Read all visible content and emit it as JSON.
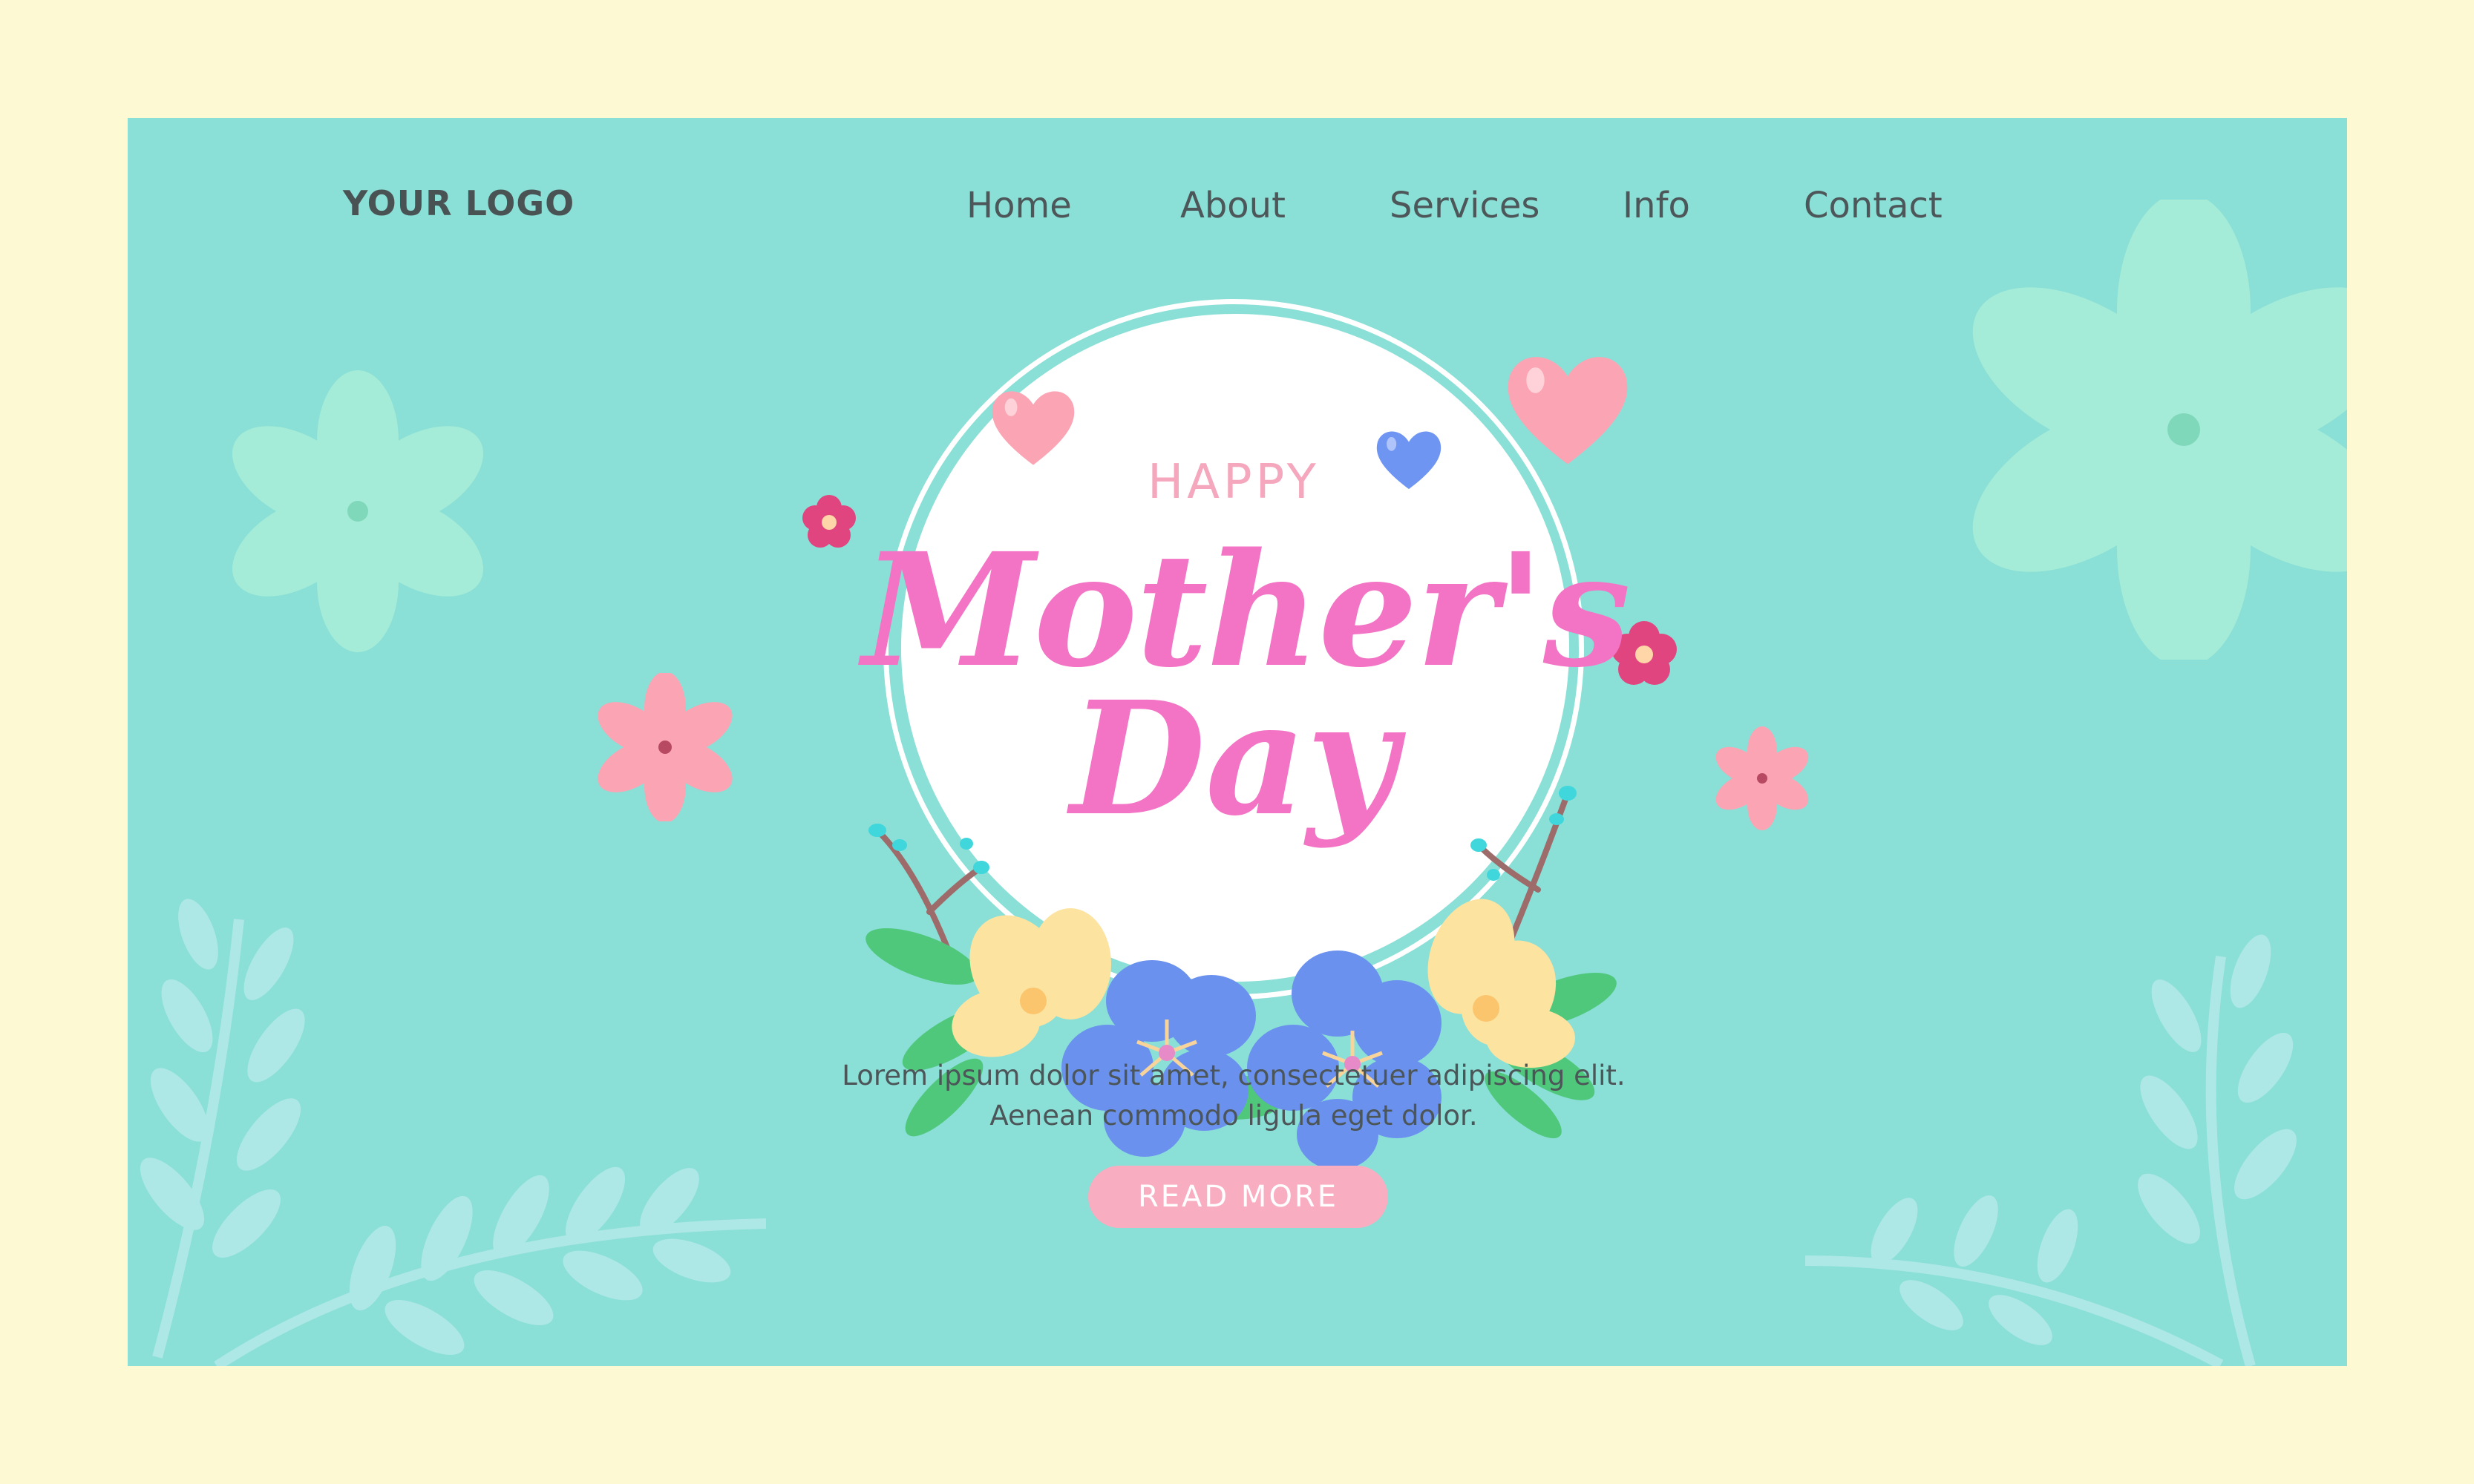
{
  "header": {
    "logo_text": "YOUR LOGO",
    "nav": [
      {
        "label": "Home"
      },
      {
        "label": "About"
      },
      {
        "label": "Services"
      },
      {
        "label": "Info"
      },
      {
        "label": "Contact"
      }
    ]
  },
  "hero": {
    "kicker": "HAPPY",
    "title_line1": "Mother's",
    "title_line2": "Day",
    "description_line1": "Lorem ipsum dolor sit amet, consectetuer adipiscing elit.",
    "description_line2": "Aenean commodo ligula eget dolor.",
    "cta_label": "READ MORE"
  },
  "colors": {
    "page_background": "#fdf9d3",
    "panel_background": "#8adfd6",
    "title_pink": "#f373c4",
    "button_pink": "#f9adc1",
    "nav_text": "#4d5658"
  }
}
